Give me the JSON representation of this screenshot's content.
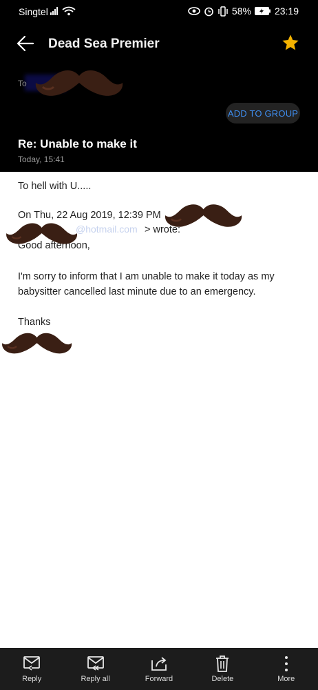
{
  "status_bar": {
    "carrier": "Singtel",
    "battery": "58%",
    "time": "23:19"
  },
  "header": {
    "title": "Dead Sea Premier",
    "to_label": "To",
    "add_to_group": "ADD TO GROUP",
    "subject": "Re: Unable to make it",
    "date": "Today, 15:41",
    "star_color": "#f5b300"
  },
  "body": {
    "line1": "To hell with U.....",
    "quote_header": "On Thu, 22 Aug 2019, 12:39 PM",
    "quote_email_partial": "@hotmail.com",
    "quote_wrote": "> wrote:",
    "greeting": "Good afternoon,",
    "para_line1": "I'm sorry to inform that I am unable to make it today as my",
    "para_line2": "babysitter cancelled last minute due to an emergency.",
    "signoff": "Thanks"
  },
  "actions": [
    {
      "label": "Reply",
      "icon": "reply-icon"
    },
    {
      "label": "Reply all",
      "icon": "reply-all-icon"
    },
    {
      "label": "Forward",
      "icon": "forward-icon"
    },
    {
      "label": "Delete",
      "icon": "trash-icon"
    },
    {
      "label": "More",
      "icon": "more-vertical-icon"
    }
  ]
}
